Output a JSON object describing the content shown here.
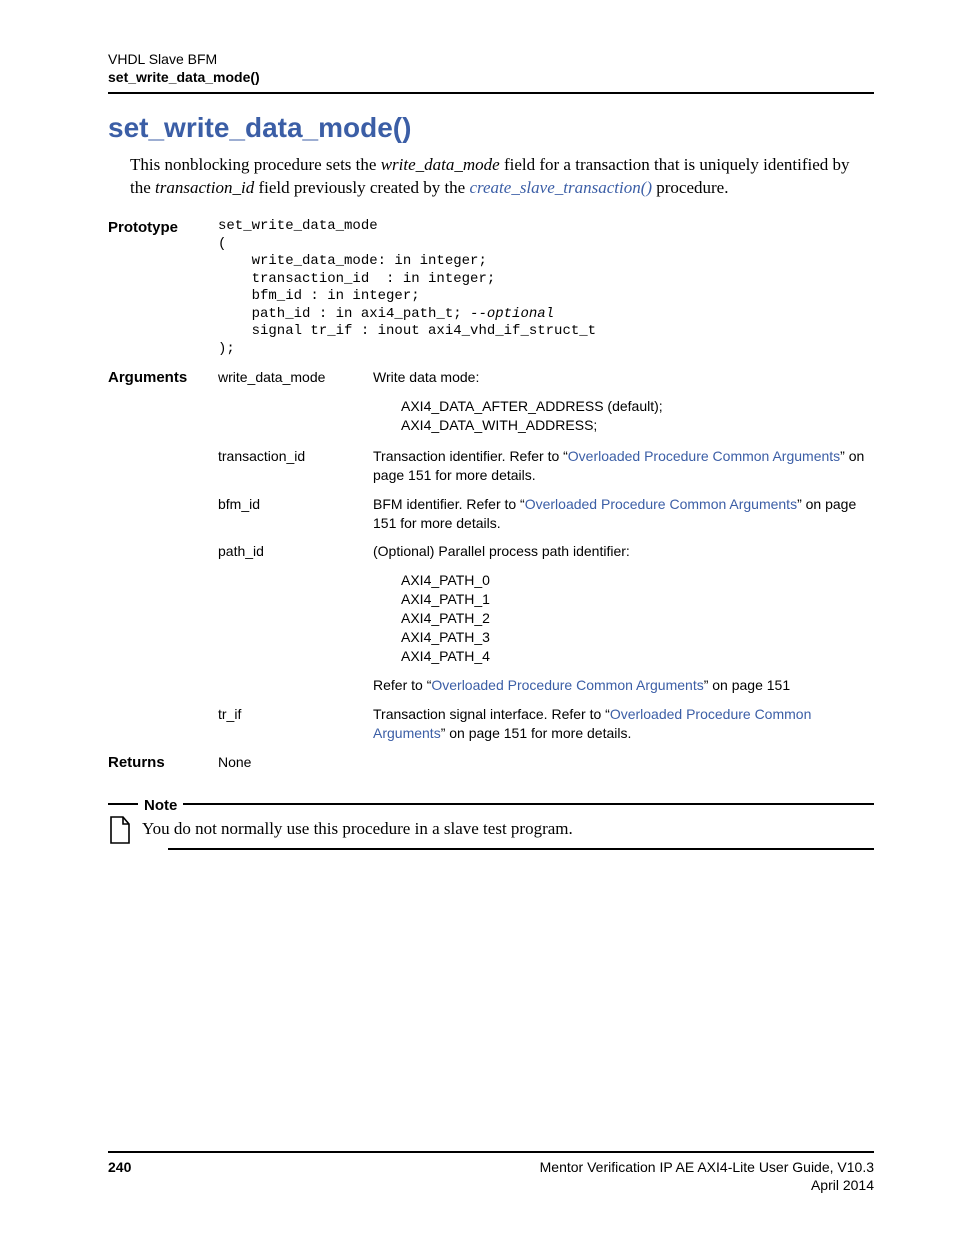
{
  "header": {
    "line1": "VHDL Slave BFM",
    "line2": "set_write_data_mode()"
  },
  "title": "set_write_data_mode()",
  "intro": {
    "pre1": "This nonblocking procedure sets the ",
    "em1": "write_data_mode",
    "mid1": " field for a transaction that is uniquely identified by the ",
    "em2": "transaction_id",
    "mid2": " field previously created by the ",
    "link": "create_slave_transaction()",
    "post": " procedure."
  },
  "prototype": {
    "label": "Prototype",
    "code": "set_write_data_mode\n(\n    write_data_mode: in integer;\n    transaction_id  : in integer;\n    bfm_id : in integer;\n    path_id : in axi4_path_t; --optional\n    signal tr_if : inout axi4_vhd_if_struct_t\n);"
  },
  "arguments": {
    "label": "Arguments",
    "items": [
      {
        "name": "write_data_mode",
        "desc_pre": "Write data mode:",
        "sub": "AXI4_DATA_AFTER_ADDRESS (default);\nAXI4_DATA_WITH_ADDRESS;"
      },
      {
        "name": "transaction_id",
        "desc_pre": "Transaction identifier. Refer to “",
        "link": "Overloaded Procedure Common Arguments",
        "desc_post": "” on page 151 for more details."
      },
      {
        "name": "bfm_id",
        "desc_pre": "BFM identifier. Refer to “",
        "link": "Overloaded Procedure Common Arguments",
        "desc_post": "” on page 151 for more details."
      },
      {
        "name": "path_id",
        "desc_pre": "(Optional) Parallel process path identifier:",
        "sub": "AXI4_PATH_0\nAXI4_PATH_1\nAXI4_PATH_2\nAXI4_PATH_3\nAXI4_PATH_4",
        "tail_pre": "Refer to “",
        "tail_link": "Overloaded Procedure Common Arguments",
        "tail_post": "” on page 151"
      },
      {
        "name": "tr_if",
        "desc_pre": "Transaction signal interface. Refer to “",
        "link": "Overloaded Procedure Common Arguments",
        "desc_post": "” on page 151 for more details."
      }
    ]
  },
  "returns": {
    "label": "Returns",
    "value": "None"
  },
  "note": {
    "label": "Note",
    "text": "You do not normally use this procedure in a slave test program."
  },
  "footer": {
    "page": "240",
    "title": "Mentor Verification IP AE AXI4-Lite User Guide, V10.3",
    "date": "April 2014"
  }
}
